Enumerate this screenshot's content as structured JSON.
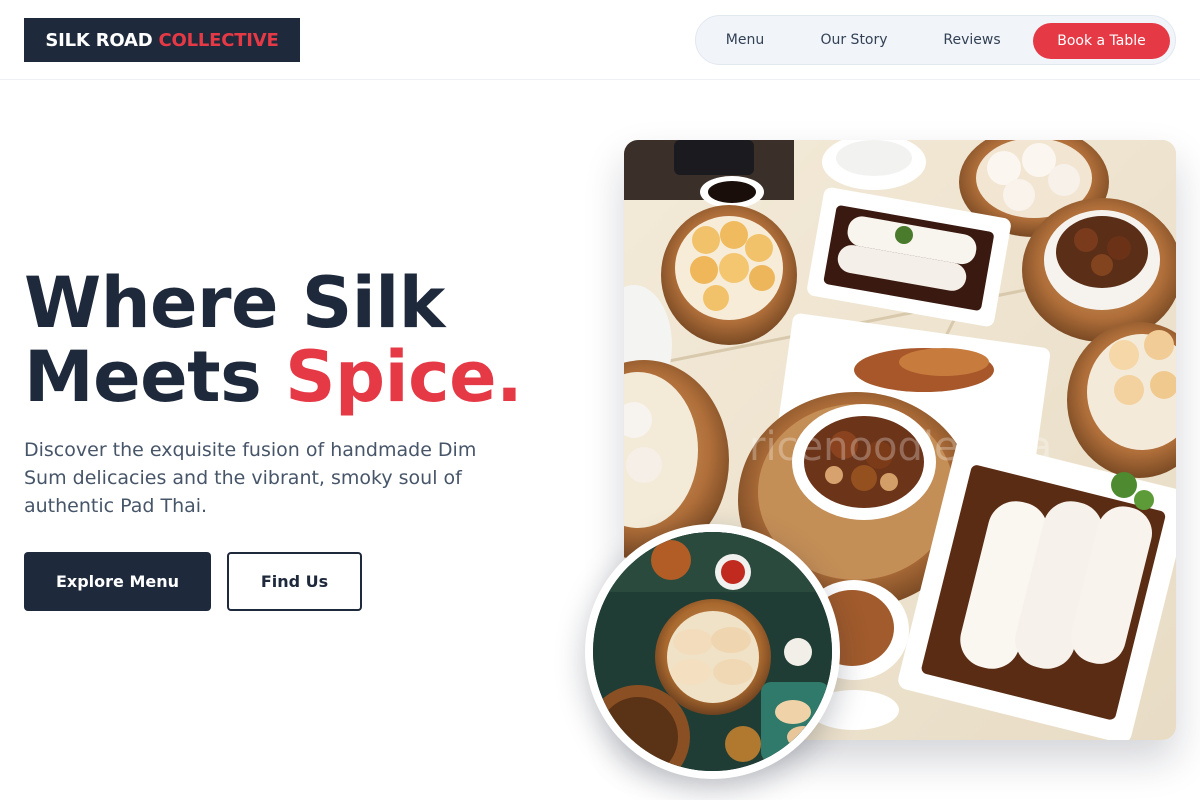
{
  "brand": {
    "name_part1": "SILK ROAD",
    "name_part2": "COLLECTIVE",
    "dark": "#1e293b",
    "accent": "#e63946"
  },
  "nav": {
    "items": [
      {
        "label": "Menu"
      },
      {
        "label": "Our Story"
      },
      {
        "label": "Reviews"
      }
    ],
    "cta_label": "Book a Table"
  },
  "hero": {
    "title_line1": "Where Silk",
    "title_line2_part1": "Meets",
    "title_line2_part2": "Spice.",
    "subtitle": "Discover the exquisite fusion of handmade Dim Sum delicacies and the vibrant, smoky soul of authentic Pad Thai.",
    "primary_button": "Explore Menu",
    "secondary_button": "Find Us"
  },
  "images": {
    "main_photo": {
      "subject": "dim-sum-table-photo",
      "watermark": "ricenoodle.asia"
    },
    "circle_photo": {
      "subject": "dumplings-bamboo-steamer-photo"
    }
  }
}
